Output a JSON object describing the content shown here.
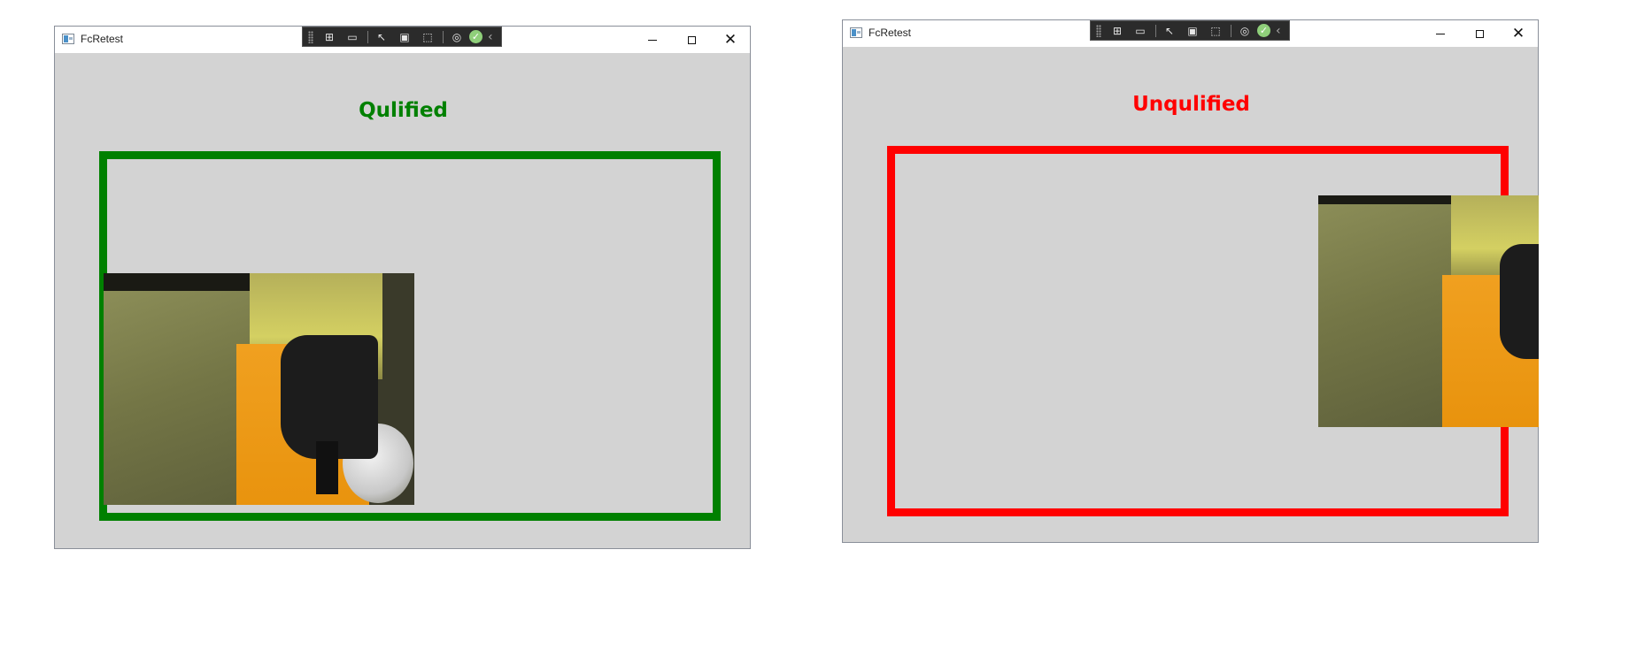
{
  "windows": [
    {
      "title": "FcRetest",
      "status_text": "Qulified",
      "status_color": "#008000",
      "frame_color": "#008000"
    },
    {
      "title": "FcRetest",
      "status_text": "Unqulified",
      "status_color": "#ff0000",
      "frame_color": "#ff0000"
    }
  ],
  "window_controls": {
    "minimize_icon": "minimize-icon",
    "maximize_icon": "maximize-icon",
    "close_icon": "close-icon"
  },
  "debug_toolbar": {
    "icons": [
      "select-element-icon",
      "camera-icon",
      "pointer-icon",
      "layout-adorner-icon",
      "track-focus-icon",
      "hot-reload-icon",
      "check-icon",
      "collapse-icon"
    ]
  }
}
